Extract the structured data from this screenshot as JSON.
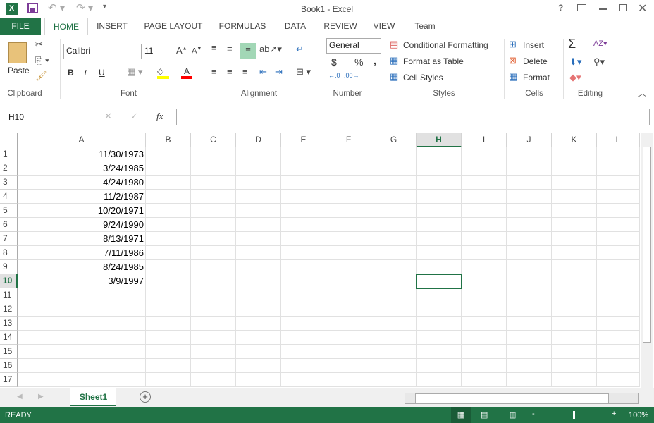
{
  "window": {
    "title": "Book1 - Excel",
    "controls": [
      "?",
      "restore-ribbon",
      "minimize",
      "restore",
      "close"
    ]
  },
  "ribbon_tabs": [
    "FILE",
    "HOME",
    "INSERT",
    "PAGE LAYOUT",
    "FORMULAS",
    "DATA",
    "REVIEW",
    "VIEW",
    "Team"
  ],
  "active_tab": "HOME",
  "clipboard": {
    "paste": "Paste",
    "label": "Clipboard"
  },
  "font": {
    "name": "Calibri",
    "size": "11",
    "label": "Font",
    "bold": "B",
    "italic": "I",
    "underline": "U",
    "font_color": "A",
    "highlight": "#ffff00",
    "font_color_hex": "#ff0000"
  },
  "alignment": {
    "label": "Alignment"
  },
  "number": {
    "format": "General",
    "currency": "$",
    "percent": "%",
    "comma": ",",
    "label": "Number"
  },
  "styles": {
    "conditional": "Conditional Formatting",
    "table": "Format as Table",
    "cell_styles": "Cell Styles",
    "label": "Styles"
  },
  "cells": {
    "insert": "Insert",
    "delete": "Delete",
    "format": "Format",
    "label": "Cells"
  },
  "editing": {
    "label": "Editing",
    "sum": "Σ"
  },
  "formula_bar": {
    "name_box": "H10",
    "fx": "fx",
    "value": ""
  },
  "columns": [
    "A",
    "B",
    "C",
    "D",
    "E",
    "F",
    "G",
    "H",
    "I",
    "J",
    "K",
    "L"
  ],
  "selected_cell": {
    "col": "H",
    "row": 10
  },
  "rows": [
    {
      "n": "1",
      "A": "11/30/1973"
    },
    {
      "n": "2",
      "A": "3/24/1985"
    },
    {
      "n": "3",
      "A": "4/24/1980"
    },
    {
      "n": "4",
      "A": "11/2/1987"
    },
    {
      "n": "5",
      "A": "10/20/1971"
    },
    {
      "n": "6",
      "A": "9/24/1990"
    },
    {
      "n": "7",
      "A": "8/13/1971"
    },
    {
      "n": "8",
      "A": "7/11/1986"
    },
    {
      "n": "9",
      "A": "8/24/1985"
    },
    {
      "n": "10",
      "A": "3/9/1997"
    },
    {
      "n": "11",
      "A": ""
    },
    {
      "n": "12",
      "A": ""
    },
    {
      "n": "13",
      "A": ""
    },
    {
      "n": "14",
      "A": ""
    },
    {
      "n": "15",
      "A": ""
    },
    {
      "n": "16",
      "A": ""
    },
    {
      "n": "17",
      "A": ""
    }
  ],
  "sheets": [
    "Sheet1"
  ],
  "status": {
    "mode": "READY",
    "zoom": "100%"
  },
  "colors": {
    "accent": "#217346"
  }
}
